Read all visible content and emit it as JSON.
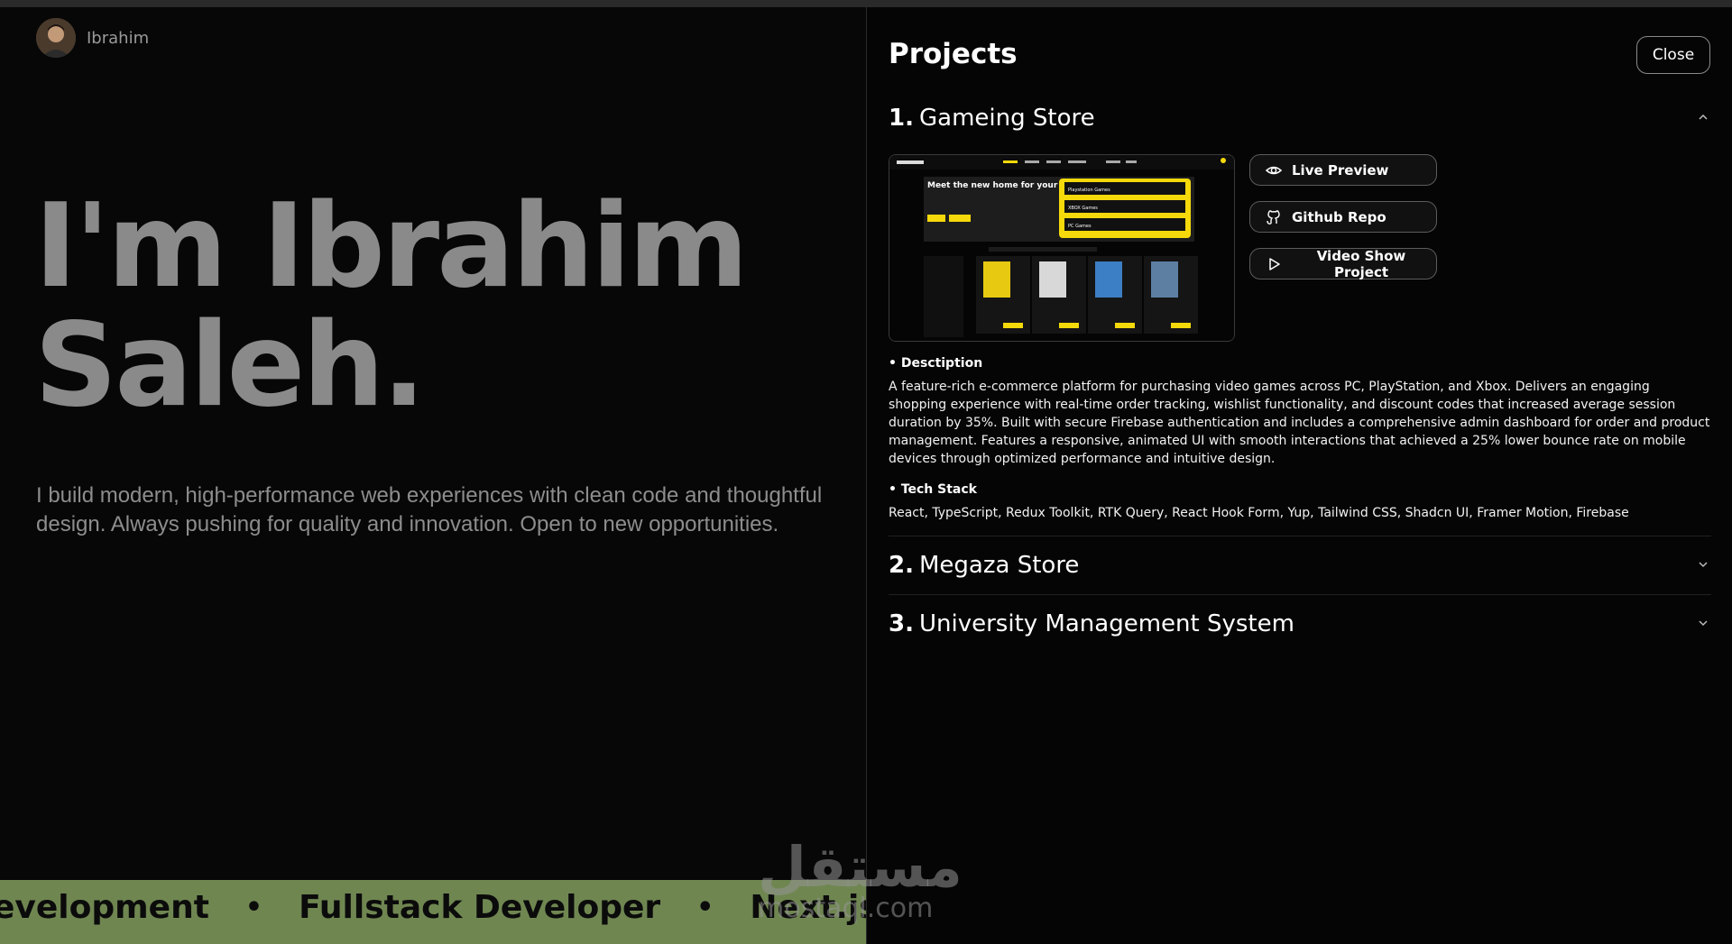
{
  "user": {
    "name": "Ibrahim"
  },
  "hero": {
    "title_line1": "I'm Ibrahim",
    "title_line2": "Saleh.",
    "description": "I build modern, high-performance web experiences with clean code and thoughtful design. Always pushing for quality and innovation. Open to new opportunities."
  },
  "marquee": {
    "items": [
      "evelopment",
      "Fullstack Developer",
      "Next.js D"
    ],
    "separator": "•"
  },
  "panel": {
    "title": "Projects",
    "close_label": "Close",
    "projects": [
      {
        "number": "1.",
        "name": "Gameing Store",
        "expanded": true,
        "actions": {
          "live_preview": "Live Preview",
          "github": "Github Repo",
          "video": "Video Show Project"
        },
        "description_label": "• Desctiption",
        "description": "A feature-rich e-commerce platform for purchasing video games across PC, PlayStation, and Xbox. Delivers an engaging shopping experience with real-time order tracking, wishlist functionality, and discount codes that increased average session duration by 35%. Built with secure Firebase authentication and includes a comprehensive admin dashboard for order and product management. Features a responsive, animated UI with smooth interactions that achieved a 25% lower bounce rate on mobile devices through optimized performance and intuitive design.",
        "tech_label": "• Tech Stack",
        "tech_stack": "React, TypeScript, Redux Toolkit, RTK Query, React Hook Form, Yup, Tailwind CSS, Shadcn UI, Framer Motion, Firebase",
        "screenshot": {
          "banner_title": "Meet the new home for your digital games",
          "options": [
            "Playstation Games",
            "XBOX Games",
            "PC Games"
          ]
        }
      },
      {
        "number": "2.",
        "name": "Megaza Store",
        "expanded": false
      },
      {
        "number": "3.",
        "name": "University Management System",
        "expanded": false
      }
    ]
  },
  "watermark": {
    "arabic": "مستقل",
    "latin": "mostaql.com"
  },
  "colors": {
    "marquee_bg": "#6f8651",
    "shot_accent": "#f5d90a"
  }
}
